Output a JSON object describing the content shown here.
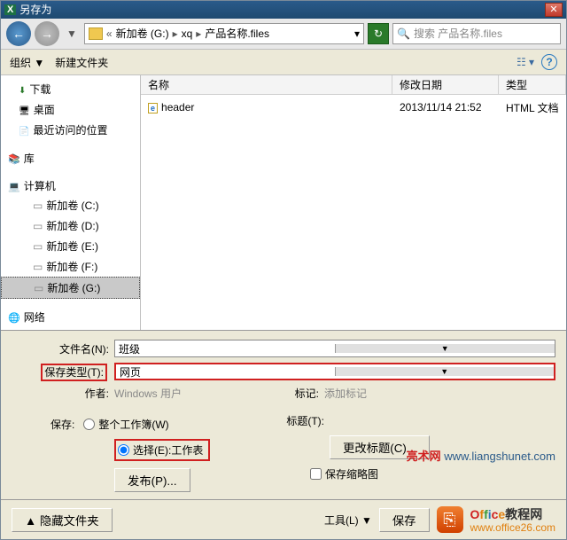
{
  "title": "另存为",
  "path": {
    "drive": "新加卷 (G:)",
    "dir1": "xq",
    "dir2": "产品名称.files"
  },
  "search_placeholder": "搜索 产品名称.files",
  "toolbar": {
    "organize": "组织 ▼",
    "newfolder": "新建文件夹"
  },
  "tree": {
    "downloads": "下载",
    "desktop": "桌面",
    "recent": "最近访问的位置",
    "libraries": "库",
    "computer": "计算机",
    "drives": [
      "新加卷 (C:)",
      "新加卷 (D:)",
      "新加卷 (E:)",
      "新加卷 (F:)",
      "新加卷 (G:)"
    ],
    "network": "网络"
  },
  "columns": {
    "name": "名称",
    "date": "修改日期",
    "type": "类型"
  },
  "files": [
    {
      "name": "header",
      "date": "2013/11/14 21:52",
      "type": "HTML 文档"
    }
  ],
  "filename_label": "文件名(N):",
  "filename_value": "班级",
  "filetype_label": "保存类型(T):",
  "filetype_value": "网页",
  "author_label": "作者:",
  "author_value": "Windows 用户",
  "tags_label": "标记:",
  "tags_value": "添加标记",
  "save_label": "保存:",
  "radio_wb": "整个工作簿(W)",
  "radio_sel": "选择(E):工作表",
  "publish_btn": "发布(P)...",
  "title_label": "标题(T):",
  "changetitle_btn": "更改标题(C)...",
  "thumb_label": "保存缩略图",
  "watermark1a": "亮术网",
  "watermark1b": "www.liangshunet.com",
  "hidefolders": "隐藏文件夹",
  "tools": "工具(L)",
  "savebtn": "保存",
  "wm2_office": "Office教程网",
  "wm2_dom": "www.office26.com"
}
